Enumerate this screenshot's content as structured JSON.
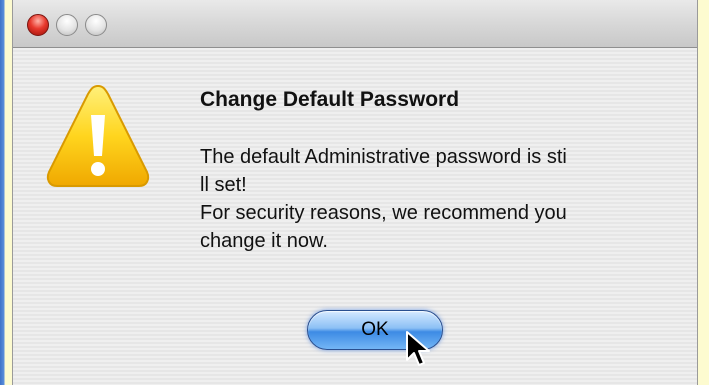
{
  "window": {
    "buttons": {
      "close": "close-icon",
      "minimize": "minimize-icon",
      "zoom": "zoom-icon"
    }
  },
  "dialog": {
    "icon": "warning-icon",
    "title": "Change Default Password",
    "message_lines": [
      "The default Administrative password is sti",
      "ll set!",
      "For security reasons, we recommend you",
      "change it now."
    ],
    "ok_label": "OK"
  },
  "colors": {
    "accent_button": "#3d8be4",
    "warning": "#f7c21a",
    "close_button": "#e8392d"
  }
}
